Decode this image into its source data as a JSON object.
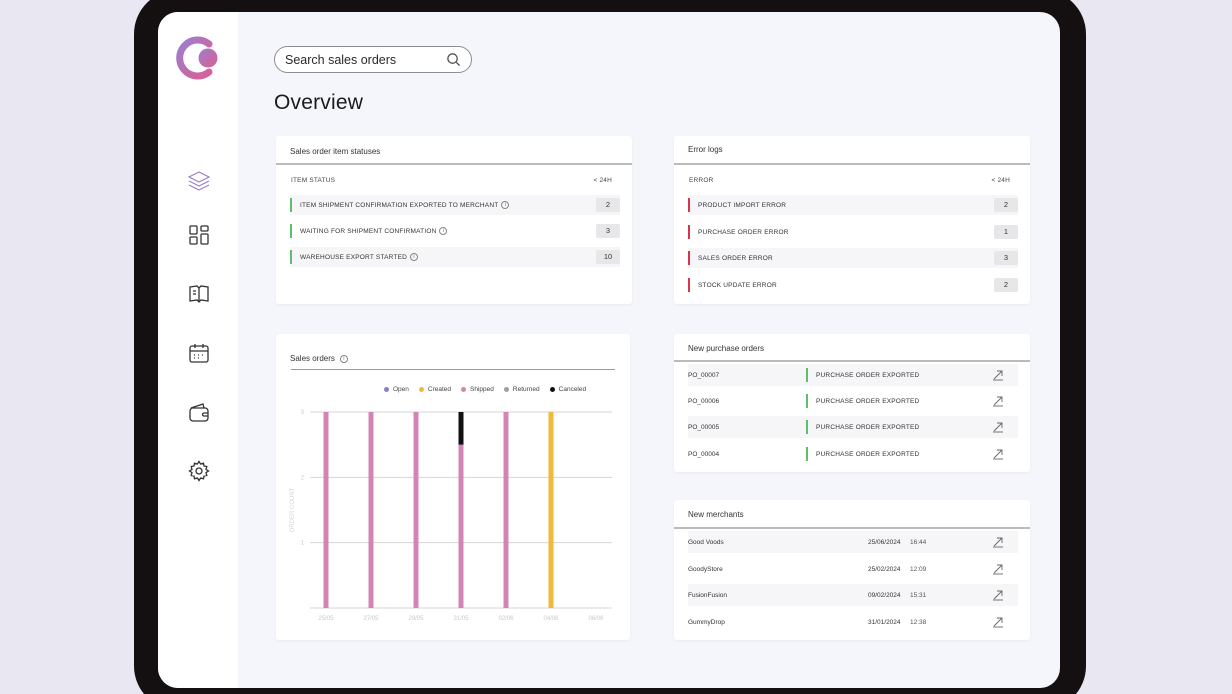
{
  "search": {
    "placeholder": "Search sales orders"
  },
  "page": {
    "title": "Overview"
  },
  "sidebar": {
    "items": [
      {
        "name": "layers",
        "icon": "layers-icon"
      },
      {
        "name": "dashboard",
        "icon": "grid-icon"
      },
      {
        "name": "catalog",
        "icon": "book-icon"
      },
      {
        "name": "calendar",
        "icon": "calendar-icon"
      },
      {
        "name": "wallet",
        "icon": "wallet-icon"
      },
      {
        "name": "settings",
        "icon": "gear-icon"
      }
    ]
  },
  "statuses": {
    "title": "Sales order item statuses",
    "col_status": "ITEM STATUS",
    "col_window": "< 24H",
    "rows": [
      {
        "label": "ITEM SHIPMENT CONFIRMATION EXPORTED TO MERCHANT",
        "count": "2"
      },
      {
        "label": "WAITING FOR SHIPMENT CONFIRMATION",
        "count": "3"
      },
      {
        "label": "WAREHOUSE EXPORT STARTED",
        "count": "10"
      }
    ],
    "indicator_color": "#5cbf6a"
  },
  "errors": {
    "title": "Error logs",
    "col_error": "ERROR",
    "col_window": "< 24H",
    "rows": [
      {
        "label": "PRODUCT IMPORT ERROR",
        "count": "2"
      },
      {
        "label": "PURCHASE ORDER ERROR",
        "count": "1"
      },
      {
        "label": "SALES ORDER ERROR",
        "count": "3"
      },
      {
        "label": "STOCK UPDATE ERROR",
        "count": "2"
      }
    ],
    "indicator_color": "#d9344f"
  },
  "purchase_orders": {
    "title": "New purchase orders",
    "rows": [
      {
        "id": "PO_00007",
        "status": "PURCHASE ORDER EXPORTED"
      },
      {
        "id": "PO_00006",
        "status": "PURCHASE ORDER EXPORTED"
      },
      {
        "id": "PO_00005",
        "status": "PURCHASE ORDER EXPORTED"
      },
      {
        "id": "PO_00004",
        "status": "PURCHASE ORDER EXPORTED"
      }
    ]
  },
  "merchants": {
    "title": "New merchants",
    "rows": [
      {
        "name": "Good Voods",
        "date": "25/06/2024",
        "time": "16:44"
      },
      {
        "name": "GoodyStore",
        "date": "25/02/2024",
        "time": "12:09"
      },
      {
        "name": "FusionFusion",
        "date": "09/02/2024",
        "time": "15:31"
      },
      {
        "name": "GummyDrop",
        "date": "31/01/2024",
        "time": "12:38"
      }
    ]
  },
  "sales_chart": {
    "title": "Sales orders",
    "legend": [
      {
        "label": "Open",
        "color": "#8a7fc4"
      },
      {
        "label": "Created",
        "color": "#f0b83c"
      },
      {
        "label": "Shipped",
        "color": "#d484b4"
      },
      {
        "label": "Returned",
        "color": "#9aa0aa"
      },
      {
        "label": "Canceled",
        "color": "#111111"
      }
    ]
  },
  "chart_data": {
    "type": "bar",
    "stacked": true,
    "title": "Sales orders",
    "ylabel": "ORDER COUNT",
    "ylim": [
      0,
      3
    ],
    "y_ticks": [
      1,
      2,
      3
    ],
    "grid": true,
    "legend_position": "top-right",
    "categories": [
      "25/05",
      "27/05",
      "29/05",
      "31/05",
      "02/06",
      "04/06",
      "06/06"
    ],
    "series": [
      {
        "name": "Open",
        "color": "#8a7fc4",
        "values": [
          0,
          0,
          0,
          0,
          0,
          0,
          0
        ]
      },
      {
        "name": "Created",
        "color": "#f0b83c",
        "values": [
          0,
          0,
          0,
          0,
          0,
          3,
          0
        ]
      },
      {
        "name": "Shipped",
        "color": "#d484b4",
        "values": [
          3,
          3,
          3,
          2.5,
          3,
          0,
          0
        ]
      },
      {
        "name": "Returned",
        "color": "#9aa0aa",
        "values": [
          0,
          0,
          0,
          0,
          0,
          0,
          0
        ]
      },
      {
        "name": "Canceled",
        "color": "#111111",
        "values": [
          0,
          0,
          0,
          0.5,
          0,
          0,
          0
        ]
      }
    ]
  }
}
